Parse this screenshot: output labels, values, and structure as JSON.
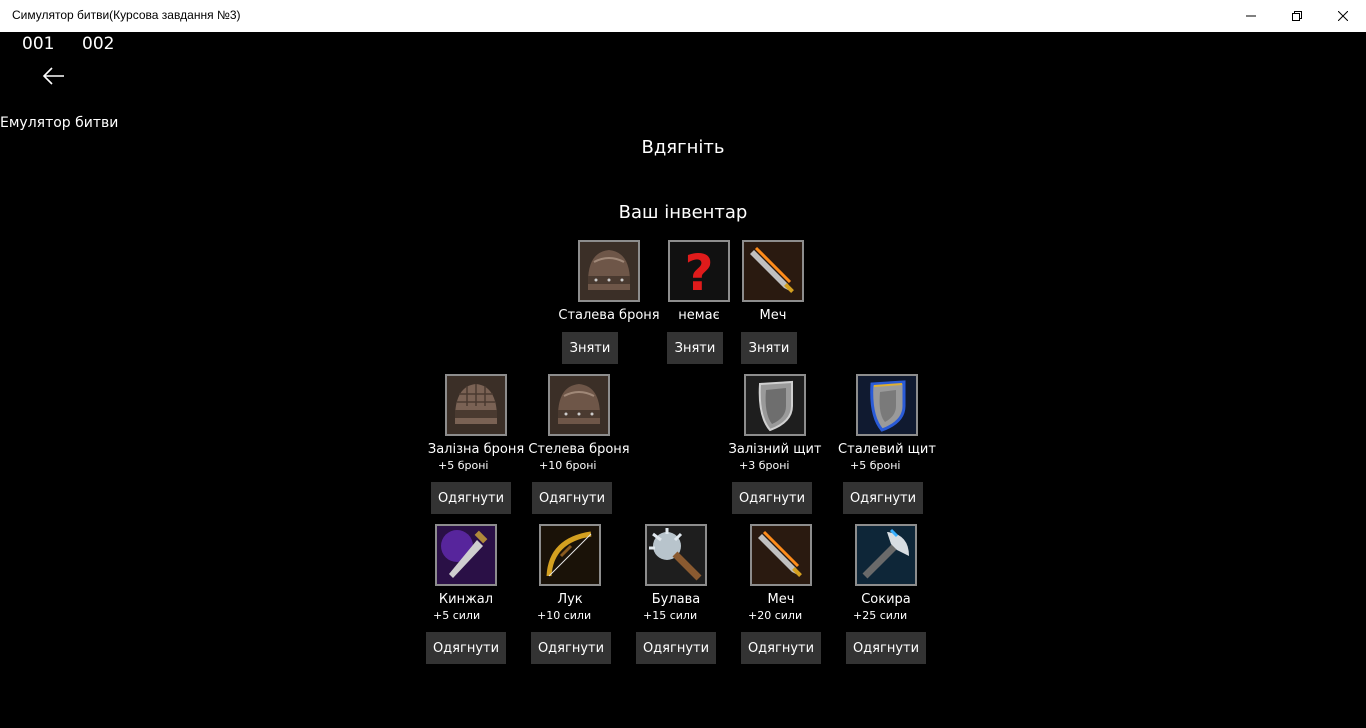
{
  "window": {
    "title": "Симулятор битви(Курсова завдання №3)"
  },
  "debug": {
    "counter1": "001",
    "counter2": "002"
  },
  "app_title": "Емулятор битви",
  "headings": {
    "dress": "Вдягніть",
    "inventory": "Ваш інвентар"
  },
  "equipped": [
    {
      "name": "Сталева броня",
      "button": "Зняти",
      "icon": "helmet-icon"
    },
    {
      "name": "немає",
      "button": "Зняти",
      "icon": "question-mark-icon"
    },
    {
      "name": "Меч",
      "button": "Зняти",
      "icon": "sword-icon"
    }
  ],
  "armor": [
    {
      "name": "Залізна броня",
      "stat": "+5 броні",
      "button": "Одягнути",
      "icon": "helmet-icon"
    },
    {
      "name": "Стелева броня",
      "stat": "+10 броні",
      "button": "Одягнути",
      "icon": "helmet-icon"
    },
    {
      "name": "Залізний щит",
      "stat": "+3 броні",
      "button": "Одягнути",
      "icon": "shield-icon"
    },
    {
      "name": "Сталевий щит",
      "stat": "+5 броні",
      "button": "Одягнути",
      "icon": "shield-icon"
    }
  ],
  "weapons": [
    {
      "name": "Кинжал",
      "stat": "+5 сили",
      "button": "Одягнути",
      "icon": "dagger-icon"
    },
    {
      "name": "Лук",
      "stat": "+10 сили",
      "button": "Одягнути",
      "icon": "bow-icon"
    },
    {
      "name": "Булава",
      "stat": "+15 сили",
      "button": "Одягнути",
      "icon": "mace-icon"
    },
    {
      "name": "Меч",
      "stat": "+20 сили",
      "button": "Одягнути",
      "icon": "sword-icon"
    },
    {
      "name": "Сокира",
      "stat": "+25 сили",
      "button": "Одягнути",
      "icon": "axe-icon"
    }
  ],
  "colors": {
    "background": "#000000",
    "button": "#333333",
    "titlebar": "#ffffff"
  }
}
